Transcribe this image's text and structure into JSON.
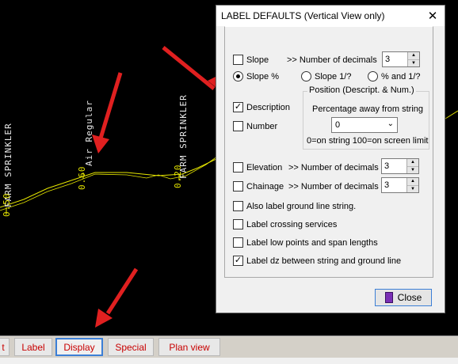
{
  "cad": {
    "labels": [
      {
        "text": "FARM SPRINKLER",
        "color": "white"
      },
      {
        "text": "Air Regular",
        "color": "white"
      },
      {
        "text": "FARM SPRINKLER",
        "color": "white"
      },
      {
        "text": "0.50",
        "color": "yellow"
      },
      {
        "text": "0.60",
        "color": "yellow"
      },
      {
        "text": "0.20",
        "color": "yellow"
      }
    ],
    "line_color": "#e6e600",
    "arrow_color": "#e02020"
  },
  "tabs": [
    {
      "label": "t",
      "active": false
    },
    {
      "label": "Label",
      "active": false
    },
    {
      "label": "Display",
      "active": true
    },
    {
      "label": "Special",
      "active": false
    },
    {
      "label": "Plan view",
      "active": false
    }
  ],
  "dialog": {
    "title": "LABEL DEFAULTS (Vertical View only)",
    "close_glyph": "✕",
    "slope": {
      "label": "Slope",
      "checked": false
    },
    "slope_decimals_label": ">> Number of decimals",
    "slope_decimals_value": "3",
    "slope_radios": [
      {
        "label": "Slope %",
        "selected": true
      },
      {
        "label": "Slope 1/?",
        "selected": false
      },
      {
        "label": "% and 1/?",
        "selected": false
      }
    ],
    "description": {
      "label": "Description",
      "checked": true
    },
    "number": {
      "label": "Number",
      "checked": false
    },
    "position_group_title": "Position (Descript. & Num.)",
    "position_caption": "Percentage away from string",
    "position_value": "0",
    "position_hint": "0=on string  100=on screen limit",
    "elevation": {
      "label": "Elevation",
      "checked": false
    },
    "elevation_decimals_label": ">> Number of decimals",
    "elevation_decimals_value": "3",
    "chainage": {
      "label": "Chainage",
      "checked": false
    },
    "chainage_decimals_label": ">> Number of decimals",
    "chainage_decimals_value": "3",
    "options": [
      {
        "label": "Also label ground line string.",
        "checked": false
      },
      {
        "label": "Label crossing services",
        "checked": false
      },
      {
        "label": "Label low points and span lengths",
        "checked": false
      },
      {
        "label": "Label dz between string and ground line",
        "checked": true
      }
    ],
    "close_button": "Close"
  }
}
